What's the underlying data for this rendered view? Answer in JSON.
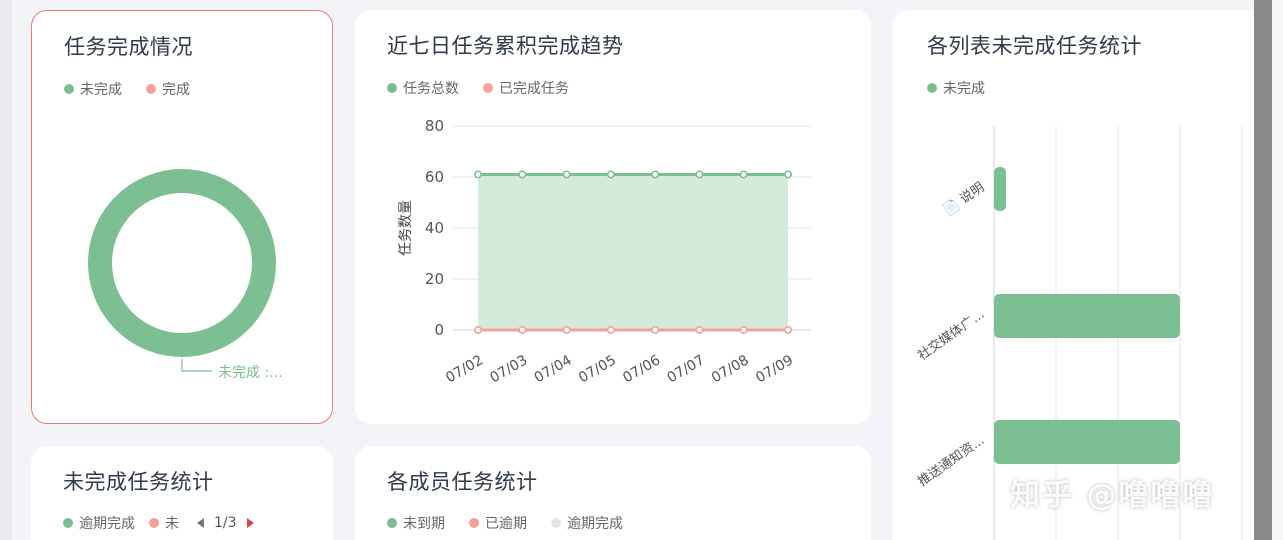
{
  "cards": {
    "task_completion": {
      "title": "任务完成情况",
      "legend": [
        {
          "label": "未完成",
          "color": "#7bbf92"
        },
        {
          "label": "完成",
          "color": "#f2a19b"
        }
      ],
      "callout_label": "未完成 :..."
    },
    "trend": {
      "title": "近七日任务累积完成趋势",
      "legend": [
        {
          "label": "任务总数",
          "color": "#7bbf92"
        },
        {
          "label": "已完成任务",
          "color": "#f2a19b"
        }
      ]
    },
    "list_unfinished": {
      "title": "各列表未完成任务统计",
      "legend": [
        {
          "label": "未完成",
          "color": "#7bbf92"
        }
      ]
    },
    "unfinished_stats": {
      "title": "未完成任务统计",
      "legend": [
        {
          "label": "逾期完成",
          "color": "#7bbf92"
        },
        {
          "label": "未",
          "color": "#f2a19b"
        }
      ],
      "pager": "1/3"
    },
    "member_stats": {
      "title": "各成员任务统计",
      "legend": [
        {
          "label": "未到期",
          "color": "#7bbf92"
        },
        {
          "label": "已逾期",
          "color": "#f2a19b"
        },
        {
          "label": "逾期完成",
          "color": "#e4e4e4"
        }
      ]
    }
  },
  "watermark": "知乎 @噜噜噜",
  "colors": {
    "green": "#7bbf92",
    "pink": "#f2a19b",
    "area": "#d4eadb",
    "grid": "#e6e6e6"
  },
  "chart_data": [
    {
      "type": "pie",
      "title": "任务完成情况",
      "style": "donut",
      "categories": [
        "未完成",
        "完成"
      ],
      "values": [
        100,
        0
      ]
    },
    {
      "type": "area",
      "title": "近七日任务累积完成趋势",
      "ylabel": "任务数量",
      "ylim": [
        0,
        80
      ],
      "yticks": [
        0,
        20,
        40,
        60,
        80
      ],
      "x": [
        "07/02",
        "07/03",
        "07/04",
        "07/05",
        "07/06",
        "07/07",
        "07/08",
        "07/09"
      ],
      "series": [
        {
          "name": "任务总数",
          "values": [
            61,
            61,
            61,
            61,
            61,
            61,
            61,
            61
          ]
        },
        {
          "name": "已完成任务",
          "values": [
            0,
            0,
            0,
            0,
            0,
            0,
            0,
            0
          ]
        }
      ],
      "grid": true
    },
    {
      "type": "bar",
      "title": "各列表未完成任务统计",
      "orientation": "horizontal",
      "categories": [
        "📄 说明",
        "社交媒体广...",
        "推送通知资..."
      ],
      "series": [
        {
          "name": "未完成",
          "values": [
            1,
            15,
            15
          ]
        }
      ],
      "xlim": [
        0,
        20
      ],
      "grid": true
    }
  ]
}
